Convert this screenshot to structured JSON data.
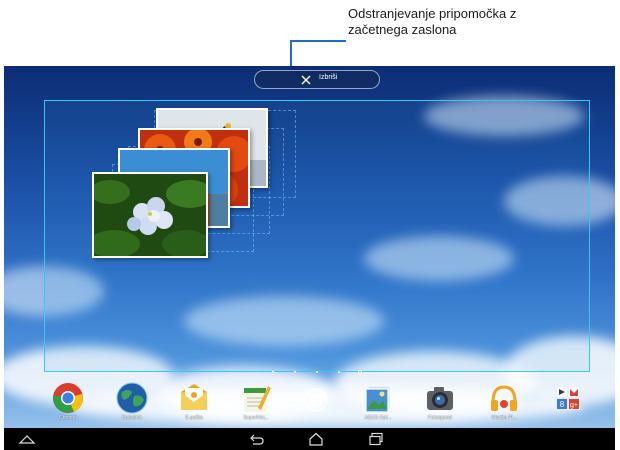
{
  "annotation": {
    "callout_line1": "Odstranjevanje pripomočka z",
    "callout_line2": "začetnega zaslona"
  },
  "remove_bar": {
    "label": "Izbriši"
  },
  "dock": {
    "apps": [
      {
        "label": "Chrome",
        "icon": "chrome-icon"
      },
      {
        "label": "Brskalnik",
        "icon": "browser-globe-icon"
      },
      {
        "label": "E-pošta",
        "icon": "email-icon"
      },
      {
        "label": "SuperNot...",
        "icon": "supernote-icon"
      },
      {
        "label": "",
        "icon": "all-apps-icon"
      },
      {
        "label": "ASUS Gal...",
        "icon": "gallery-icon"
      },
      {
        "label": "Fotoaparat",
        "icon": "camera-icon"
      },
      {
        "label": "Glasba Pl...",
        "icon": "headphones-icon"
      },
      {
        "label": "",
        "icon": "google-apps-folder-icon"
      }
    ]
  },
  "page_indicator": {
    "count": 5,
    "current": 5
  },
  "colors": {
    "highlight": "#39c6f0",
    "callout": "#1f6fc1",
    "navbar": "#000000"
  }
}
